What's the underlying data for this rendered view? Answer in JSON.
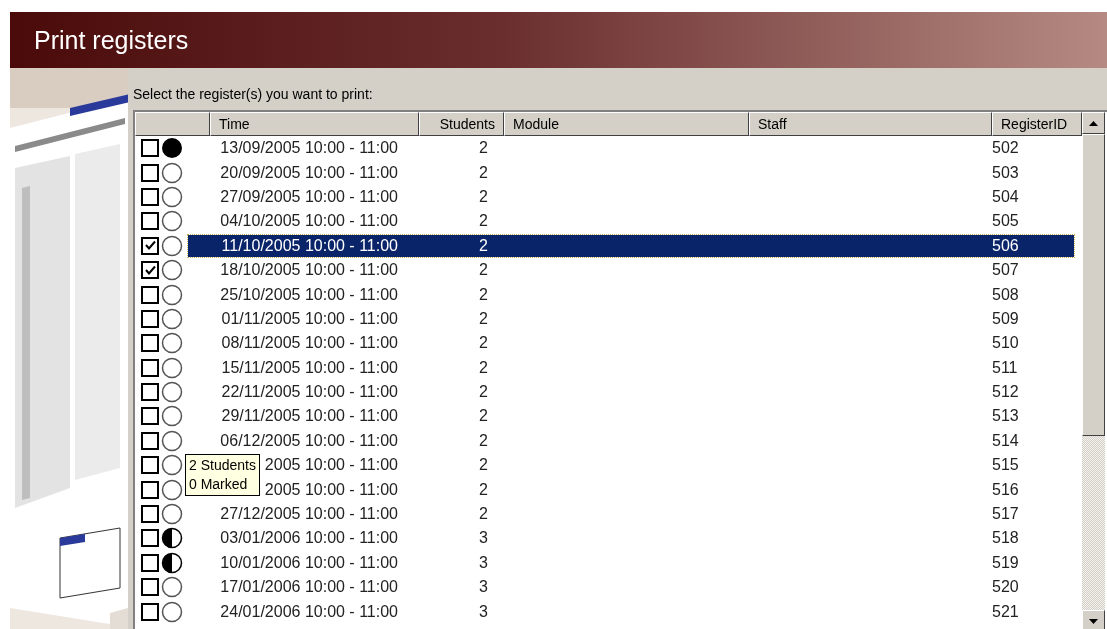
{
  "window": {
    "title": "Print registers"
  },
  "instruction": "Select the register(s) you want to print:",
  "table": {
    "columns": [
      "Time",
      "Students",
      "Module",
      "Staff",
      "RegisterID"
    ],
    "rows": [
      {
        "checked": false,
        "kind": "full",
        "selected": false,
        "time": "13/09/2005 10:00 - 11:00",
        "students": "2",
        "id": "502"
      },
      {
        "checked": false,
        "kind": "none",
        "selected": false,
        "time": "20/09/2005 10:00 - 11:00",
        "students": "2",
        "id": "503"
      },
      {
        "checked": false,
        "kind": "none",
        "selected": false,
        "time": "27/09/2005 10:00 - 11:00",
        "students": "2",
        "id": "504"
      },
      {
        "checked": false,
        "kind": "none",
        "selected": false,
        "time": "04/10/2005 10:00 - 11:00",
        "students": "2",
        "id": "505"
      },
      {
        "checked": true,
        "kind": "none",
        "selected": true,
        "time": "11/10/2005 10:00 - 11:00",
        "students": "2",
        "id": "506"
      },
      {
        "checked": true,
        "kind": "none",
        "selected": false,
        "time": "18/10/2005 10:00 - 11:00",
        "students": "2",
        "id": "507"
      },
      {
        "checked": false,
        "kind": "none",
        "selected": false,
        "time": "25/10/2005 10:00 - 11:00",
        "students": "2",
        "id": "508"
      },
      {
        "checked": false,
        "kind": "none",
        "selected": false,
        "time": "01/11/2005 10:00 - 11:00",
        "students": "2",
        "id": "509"
      },
      {
        "checked": false,
        "kind": "none",
        "selected": false,
        "time": "08/11/2005 10:00 - 11:00",
        "students": "2",
        "id": "510"
      },
      {
        "checked": false,
        "kind": "none",
        "selected": false,
        "time": "15/11/2005 10:00 - 11:00",
        "students": "2",
        "id": "511"
      },
      {
        "checked": false,
        "kind": "none",
        "selected": false,
        "time": "22/11/2005 10:00 - 11:00",
        "students": "2",
        "id": "512"
      },
      {
        "checked": false,
        "kind": "none",
        "selected": false,
        "time": "29/11/2005 10:00 - 11:00",
        "students": "2",
        "id": "513"
      },
      {
        "checked": false,
        "kind": "none",
        "selected": false,
        "time": "06/12/2005 10:00 - 11:00",
        "students": "2",
        "id": "514"
      },
      {
        "checked": false,
        "kind": "none",
        "selected": false,
        "time": "2005 10:00 - 11:00",
        "students": "2",
        "id": "515"
      },
      {
        "checked": false,
        "kind": "none",
        "selected": false,
        "time": "2005 10:00 - 11:00",
        "students": "2",
        "id": "516"
      },
      {
        "checked": false,
        "kind": "none",
        "selected": false,
        "time": "27/12/2005 10:00 - 11:00",
        "students": "2",
        "id": "517"
      },
      {
        "checked": false,
        "kind": "half",
        "selected": false,
        "time": "03/01/2006 10:00 - 11:00",
        "students": "3",
        "id": "518"
      },
      {
        "checked": false,
        "kind": "half",
        "selected": false,
        "time": "10/01/2006 10:00 - 11:00",
        "students": "3",
        "id": "519"
      },
      {
        "checked": false,
        "kind": "none",
        "selected": false,
        "time": "17/01/2006 10:00 - 11:00",
        "students": "3",
        "id": "520"
      },
      {
        "checked": false,
        "kind": "none",
        "selected": false,
        "time": "24/01/2006 10:00 - 11:00",
        "students": "3",
        "id": "521"
      }
    ]
  },
  "tooltip": {
    "lines": [
      "2 Students",
      "0 Marked"
    ]
  }
}
